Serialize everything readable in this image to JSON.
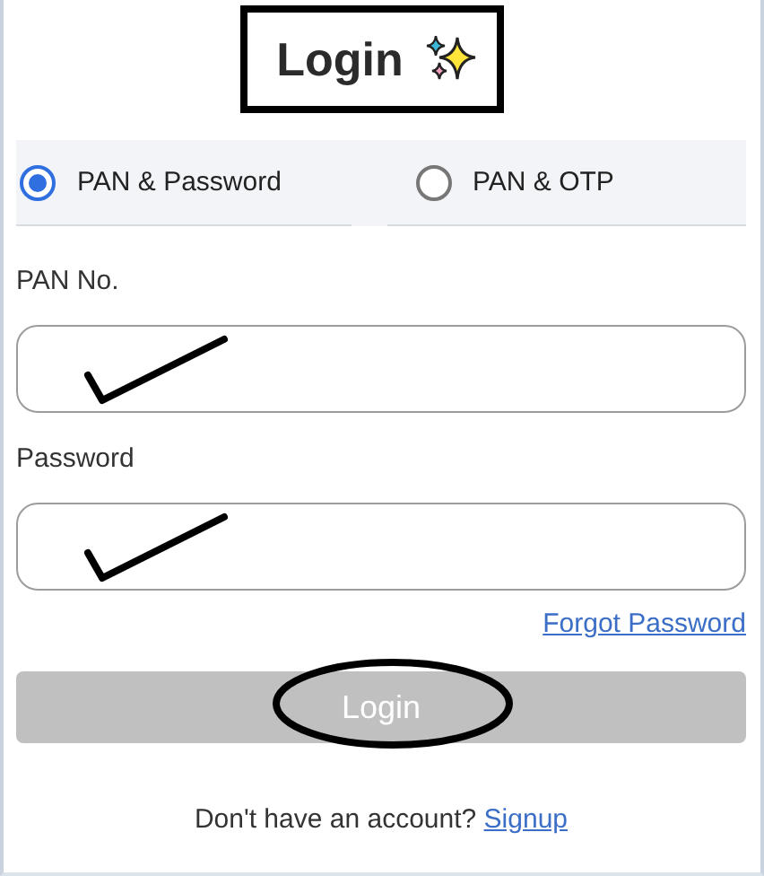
{
  "title": "Login",
  "login_modes": [
    {
      "label": "PAN & Password",
      "selected": true
    },
    {
      "label": "PAN & OTP",
      "selected": false
    }
  ],
  "fields": [
    {
      "label": "PAN No."
    },
    {
      "label": "Password"
    }
  ],
  "forgot_link": "Forgot Password",
  "submit": {
    "label": "Login",
    "disabled": true
  },
  "footer": {
    "text": "Don't have an account?",
    "link": "Signup"
  }
}
